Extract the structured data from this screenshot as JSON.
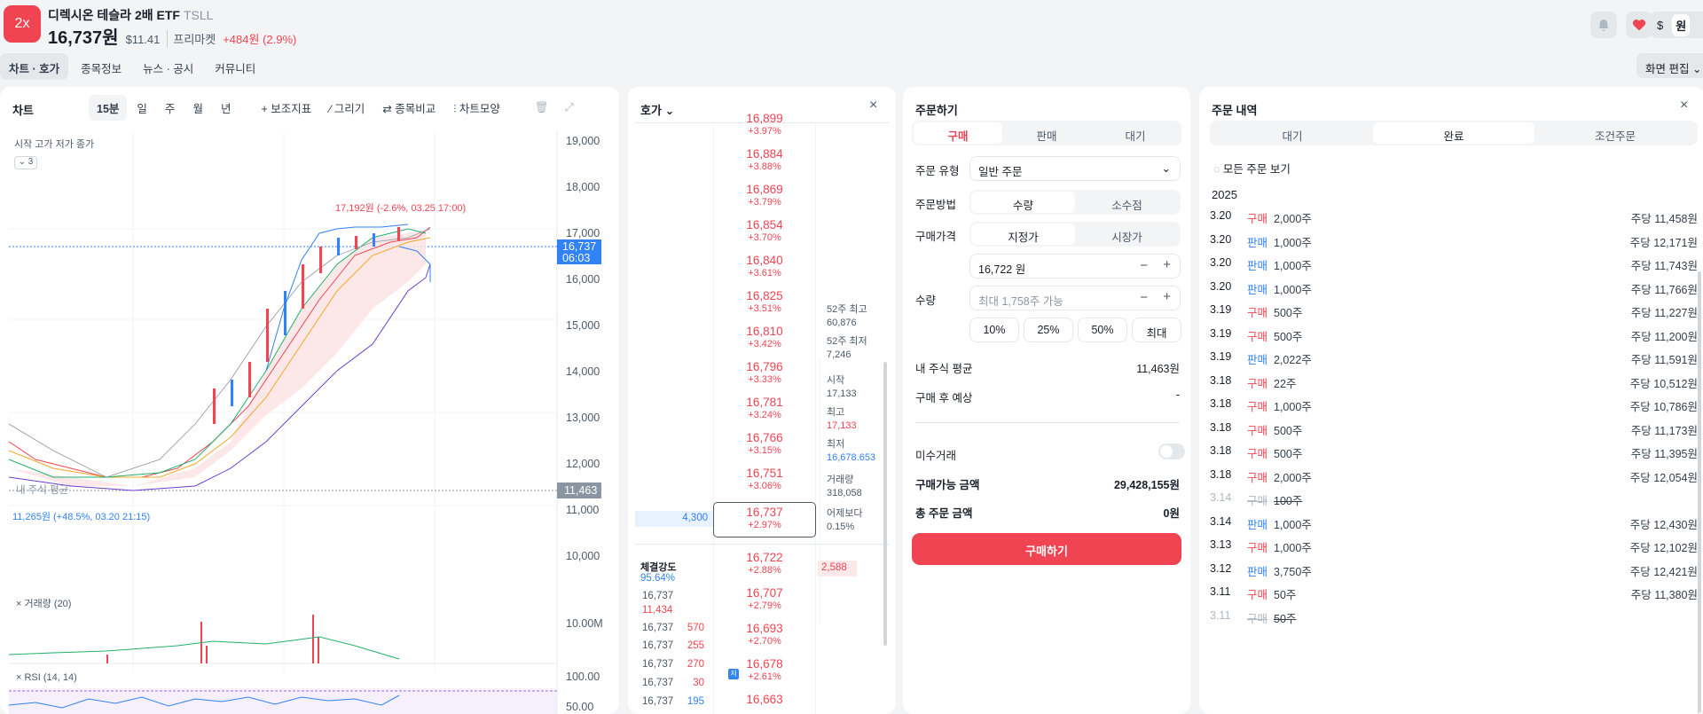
{
  "header": {
    "logo": "2x",
    "name": "디렉시온 테슬라 2배 ETF",
    "ticker": "TSLL",
    "price": "16,737원",
    "usd": "$11.41",
    "session": "프리마켓",
    "change": "+484원 (2.9%)",
    "currency": [
      "$",
      "원"
    ]
  },
  "tabs": [
    "차트 · 호가",
    "종목정보",
    "뉴스 · 공시",
    "커뮤니티"
  ],
  "edit_label": "화면 편집",
  "chart": {
    "title": "차트",
    "toolbar": [
      "15분",
      "일",
      "주",
      "월",
      "년",
      "+ 보조지표",
      "∕ 그리기",
      "⇄ 종목비교",
      "⫶ 차트모양"
    ],
    "ohlc_label": "시작 고가 저가 종가",
    "collapse": "3",
    "y_ticks": [
      "19,000",
      "18,000",
      "17,000",
      "16,000",
      "15,000",
      "14,000",
      "13,000",
      "12,000",
      "11,000",
      "10,000"
    ],
    "current_price": "16,737",
    "current_time": "06:03",
    "avg_label": "11,463",
    "avg_text": "내 주식 평균",
    "high_note": "17,192원 (-2.6%, 03.25 17:00)",
    "low_note": "11,265원 (+48.5%, 03.20 21:15)",
    "volume_label": "거래량 (20)",
    "volume_tick": "10.00M",
    "rsi_label": "RSI (14, 14)",
    "rsi_ticks": [
      "100.00",
      "50.00"
    ]
  },
  "orderbook": {
    "title": "호가",
    "asks": [
      [
        "16,899",
        "+3.97%"
      ],
      [
        "16,884",
        "+3.88%"
      ],
      [
        "16,869",
        "+3.79%"
      ],
      [
        "16,854",
        "+3.70%"
      ],
      [
        "16,840",
        "+3.61%"
      ],
      [
        "16,825",
        "+3.51%"
      ],
      [
        "16,810",
        "+3.42%"
      ],
      [
        "16,796",
        "+3.33%"
      ],
      [
        "16,781",
        "+3.24%"
      ],
      [
        "16,766",
        "+3.15%"
      ],
      [
        "16,751",
        "+3.06%"
      ]
    ],
    "current": [
      "16,737",
      "+2.97%"
    ],
    "current_qty": "4,300",
    "bids": [
      [
        "16,722",
        "+2.88%"
      ],
      [
        "16,707",
        "+2.79%"
      ],
      [
        "16,693",
        "+2.70%"
      ],
      [
        "16,678",
        "+2.61%"
      ],
      [
        "16,663",
        ""
      ]
    ],
    "bid_qty": "2,588",
    "side": [
      [
        "52주 최고",
        "60,876"
      ],
      [
        "52주 최저",
        "7,246"
      ],
      [
        "시작",
        "17,133"
      ],
      [
        "최고",
        "17,133"
      ],
      [
        "최저",
        "16,678.653"
      ],
      [
        "거래량",
        "318,058"
      ],
      [
        "어제보다",
        "0.15%"
      ]
    ],
    "strength_label": "체결강도",
    "strength": "95.64%",
    "trades": [
      [
        "16,737",
        "11,434"
      ],
      [
        "16,737",
        "570"
      ],
      [
        "16,737",
        "255"
      ],
      [
        "16,737",
        "270"
      ],
      [
        "16,737",
        "30"
      ],
      [
        "16,737",
        "195"
      ]
    ],
    "marker": "저"
  },
  "order": {
    "title": "주문하기",
    "tabs": [
      "구매",
      "판매",
      "대기"
    ],
    "type_label": "주문 유형",
    "type_value": "일반 주문",
    "method_label": "주문방법",
    "methods": [
      "수량",
      "소수점"
    ],
    "price_type_label": "구매가격",
    "price_types": [
      "지정가",
      "시장가"
    ],
    "price_value": "16,722 원",
    "qty_label": "수량",
    "qty_placeholder": "최대 1,758주 가능",
    "pcts": [
      "10%",
      "25%",
      "50%",
      "최대"
    ],
    "avg_label": "내 주식 평균",
    "avg_value": "11,463원",
    "after_label": "구매 후 예상",
    "after_value": "-",
    "unsettled_label": "미수거래",
    "avail_label": "구매가능 금액",
    "avail_value": "29,428,155원",
    "total_label": "총 주문 금액",
    "total_value": "0원",
    "submit": "구매하기"
  },
  "history": {
    "title": "주문 내역",
    "tabs": [
      "대기",
      "완료",
      "조건주문"
    ],
    "all_label": "모든 주문 보기",
    "year": "2025",
    "rows": [
      {
        "date": "3.20",
        "type": "구매",
        "qty": "2,000주",
        "price": "주당 11,458원"
      },
      {
        "date": "3.20",
        "type": "판매",
        "qty": "1,000주",
        "price": "주당 12,171원"
      },
      {
        "date": "3.20",
        "type": "판매",
        "qty": "1,000주",
        "price": "주당 11,743원"
      },
      {
        "date": "3.20",
        "type": "판매",
        "qty": "1,000주",
        "price": "주당 11,766원"
      },
      {
        "date": "3.19",
        "type": "구매",
        "qty": "500주",
        "price": "주당 11,227원"
      },
      {
        "date": "3.19",
        "type": "구매",
        "qty": "500주",
        "price": "주당 11,200원"
      },
      {
        "date": "3.19",
        "type": "판매",
        "qty": "2,022주",
        "price": "주당 11,591원"
      },
      {
        "date": "3.18",
        "type": "구매",
        "qty": "22주",
        "price": "주당 10,512원"
      },
      {
        "date": "3.18",
        "type": "구매",
        "qty": "1,000주",
        "price": "주당 10,786원"
      },
      {
        "date": "3.18",
        "type": "구매",
        "qty": "500주",
        "price": "주당 11,173원"
      },
      {
        "date": "3.18",
        "type": "구매",
        "qty": "500주",
        "price": "주당 11,395원"
      },
      {
        "date": "3.18",
        "type": "구매",
        "qty": "2,000주",
        "price": "주당 12,054원"
      },
      {
        "date": "3.14",
        "type": "구매",
        "qty": "100주",
        "price": "",
        "cancelled": true
      },
      {
        "date": "3.14",
        "type": "판매",
        "qty": "1,000주",
        "price": "주당 12,430원"
      },
      {
        "date": "3.13",
        "type": "구매",
        "qty": "1,000주",
        "price": "주당 12,102원"
      },
      {
        "date": "3.12",
        "type": "판매",
        "qty": "3,750주",
        "price": "주당 12,421원"
      },
      {
        "date": "3.11",
        "type": "구매",
        "qty": "50주",
        "price": "주당 11,380원"
      },
      {
        "date": "3.11",
        "type": "구매",
        "qty": "50주",
        "price": "",
        "cancelled": true
      }
    ]
  },
  "colors": {
    "up": "#f04452",
    "down": "#3182f6",
    "accent_bg": "#f2f4f6"
  }
}
